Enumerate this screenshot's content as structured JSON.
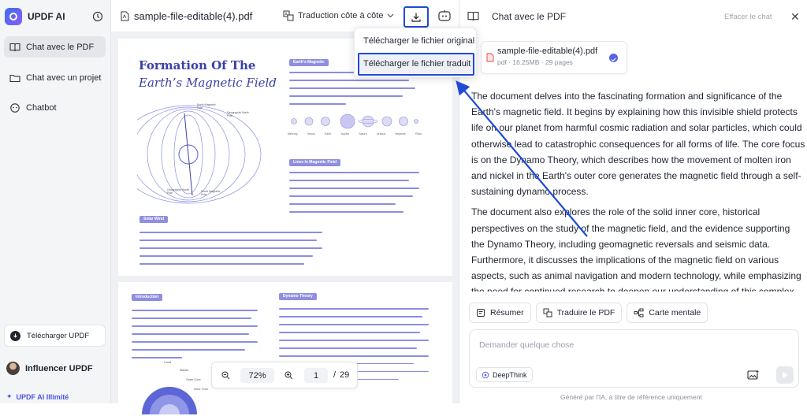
{
  "app": {
    "name": "UPDF AI",
    "ai_unlimited": "UPDF AI Illimité"
  },
  "sidebar": {
    "items": [
      {
        "label": "Chat avec le PDF",
        "icon": "book-icon",
        "active": true
      },
      {
        "label": "Chat avec un projet",
        "icon": "folder-icon",
        "active": false
      },
      {
        "label": "Chatbot",
        "icon": "chatbot-icon",
        "active": false
      }
    ],
    "download_label": "Télécharger UPDF",
    "user_name": "Influencer UPDF"
  },
  "toolbar": {
    "file_title": "sample-file-editable(4).pdf",
    "translate_mode": "Traduction côte à côte"
  },
  "download_menu": {
    "items": [
      "Télécharger le fichier original",
      "Télécharger le fichier traduit"
    ],
    "highlighted_index": 1
  },
  "document": {
    "title_line1": "Formation Of The",
    "title_line2": "Earth’s Magnetic Field",
    "sections": [
      "Earth's Magnetic",
      "Lines In Magnetic Field",
      "Solar Wind",
      "Introduction",
      "Dynamo Theory"
    ],
    "planet_labels": [
      "Mercury",
      "Venus",
      "Earth",
      "Jupiter",
      "Saturn",
      "Uranus",
      "Neptune",
      "Pluto"
    ],
    "diagram_labels": [
      "Geographic North Pole",
      "Geographic South Pole",
      "South Magnetic Pole",
      "North Magnetic Pole"
    ],
    "mini_labels": [
      "Crust",
      "Mantle",
      "Outer Core",
      "Inner Core"
    ]
  },
  "zoom": {
    "level": "72%",
    "current_page": "1",
    "separator": "/",
    "total_pages": "29"
  },
  "chat": {
    "title": "Chat avec le PDF",
    "clear_label": "Effacer le chat",
    "file_card": {
      "name": "sample-file-editable(4).pdf",
      "meta": "pdf · 16.25MB · 29 pages"
    },
    "answer_paragraphs": [
      "The document delves into the fascinating formation and significance of the Earth's magnetic field. It begins by explaining how this invisible shield protects life on our planet from harmful cosmic radiation and solar particles, which could otherwise lead to catastrophic consequences for all forms of life. The core focus is on the Dynamo Theory, which describes how the movement of molten iron and nickel in the Earth's outer core generates the magnetic field through a self-sustaining dynamo process.",
      "The document also explores the role of the solid inner core, historical perspectives on the study of the magnetic field, and the evidence supporting the Dynamo Theory, including geomagnetic reversals and seismic data. Furthermore, it discusses the implications of the magnetic field on various aspects, such as animal navigation and modern technology, while emphasizing the need for continued research to deepen our understanding of this complex"
    ],
    "chips": [
      "Résumer",
      "Traduire le PDF",
      "Carte mentale"
    ],
    "input_placeholder": "Demander quelque chose",
    "deepthink_label": "DeepThink",
    "disclaimer": "Généré par l'IA, à titre de référence uniquement"
  },
  "colors": {
    "accent": "#1f4bd6",
    "brand_purple": "#5961e8",
    "doc_text": "#3a3fa8"
  }
}
